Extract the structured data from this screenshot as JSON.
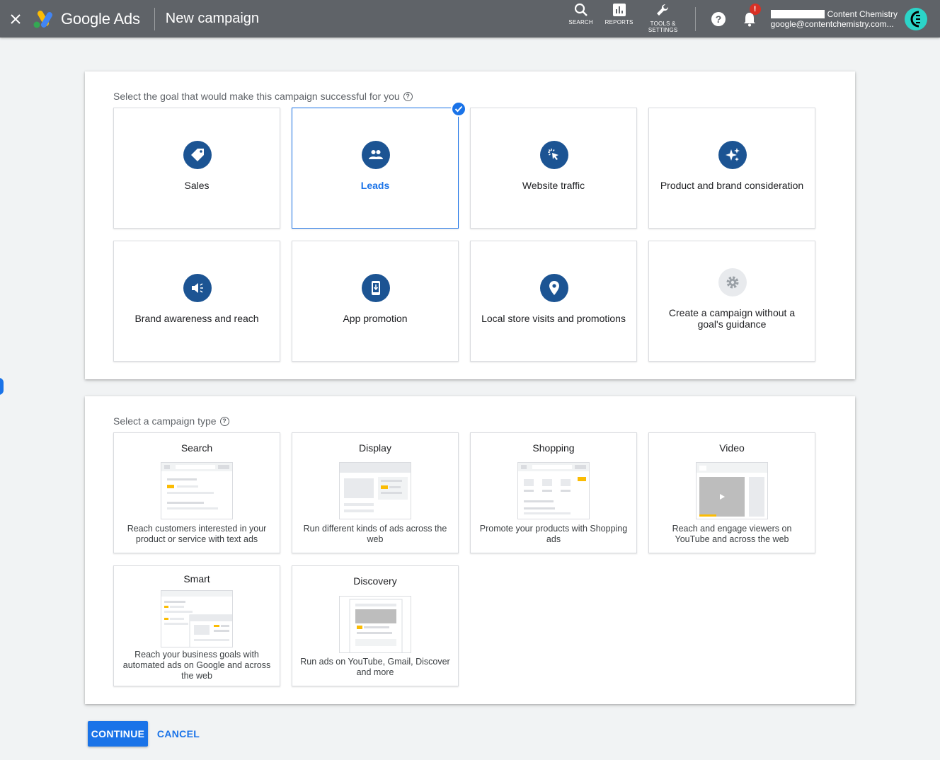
{
  "header": {
    "product_name": "Google Ads",
    "page_title": "New campaign",
    "tools": [
      {
        "label": "SEARCH",
        "icon": "search-icon"
      },
      {
        "label": "REPORTS",
        "icon": "reports-icon"
      },
      {
        "label": "TOOLS &\nSETTINGS",
        "icon": "wrench-icon"
      }
    ],
    "notification_count": "!",
    "account_name": "Content Chemistry",
    "account_email": "google@contentchemistry.com..."
  },
  "goals": {
    "label": "Select the goal that would make this campaign successful for you",
    "items": [
      {
        "label": "Sales",
        "icon": "tag-icon",
        "selected": false
      },
      {
        "label": "Leads",
        "icon": "people-icon",
        "selected": true
      },
      {
        "label": "Website traffic",
        "icon": "cursor-click-icon",
        "selected": false
      },
      {
        "label": "Product and brand consideration",
        "icon": "sparkle-icon",
        "selected": false
      },
      {
        "label": "Brand awareness and reach",
        "icon": "megaphone-icon",
        "selected": false
      },
      {
        "label": "App promotion",
        "icon": "phone-download-icon",
        "selected": false
      },
      {
        "label": "Local store visits and promotions",
        "icon": "location-pin-icon",
        "selected": false
      },
      {
        "label": "Create a campaign without a goal's guidance",
        "icon": "gear-icon",
        "selected": false
      }
    ]
  },
  "campaign_types": {
    "label": "Select a campaign type",
    "items": [
      {
        "title": "Search",
        "description": "Reach customers interested in your product or service with text ads"
      },
      {
        "title": "Display",
        "description": "Run different kinds of ads across the web"
      },
      {
        "title": "Shopping",
        "description": "Promote your products with Shopping ads"
      },
      {
        "title": "Video",
        "description": "Reach and engage viewers on YouTube and across the web"
      },
      {
        "title": "Smart",
        "description": "Reach your business goals with automated ads on Google and across the web"
      },
      {
        "title": "Discovery",
        "description": "Run ads on YouTube, Gmail, Discover and more"
      }
    ]
  },
  "actions": {
    "continue_label": "CONTINUE",
    "cancel_label": "CANCEL"
  },
  "colors": {
    "header_bg": "#5f6368",
    "accent": "#1a73e8",
    "goal_icon_bg": "#1c5493",
    "illustration_highlight": "#fbbc04"
  }
}
